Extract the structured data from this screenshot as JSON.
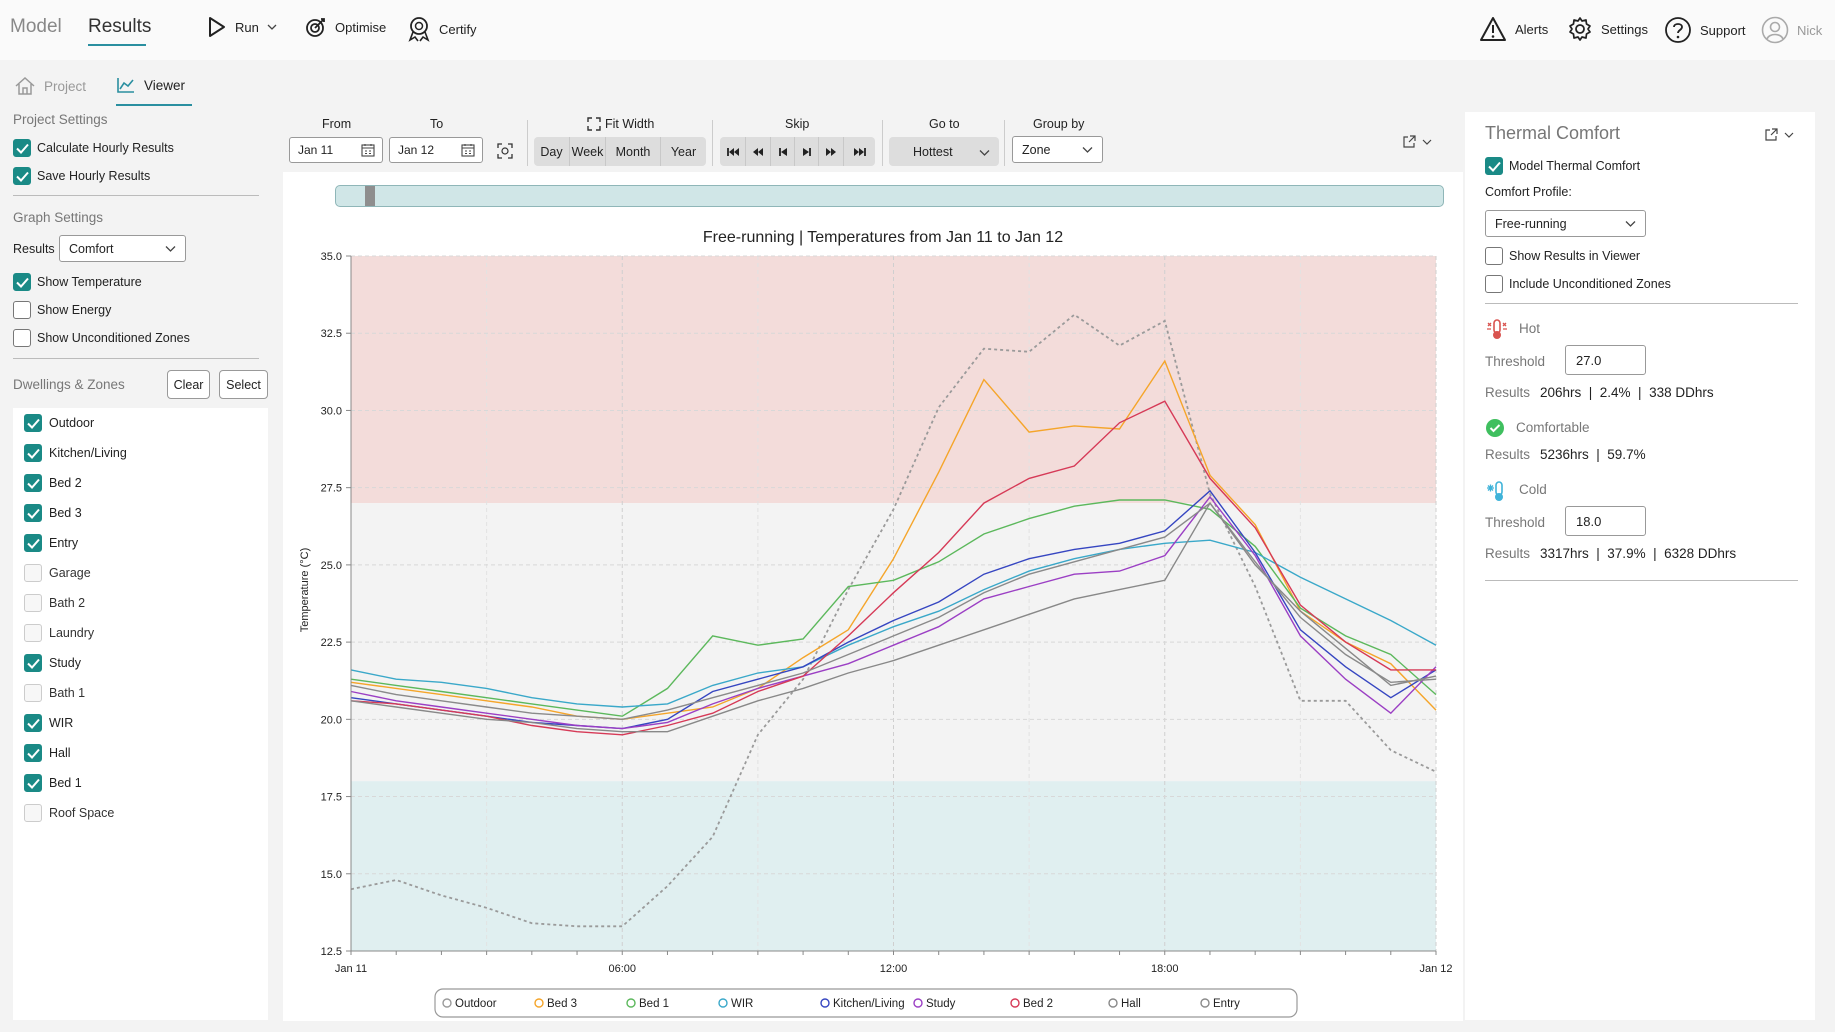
{
  "topbar": {
    "tabs": [
      {
        "label": "Model"
      },
      {
        "label": "Results"
      }
    ],
    "tools": {
      "run": "Run",
      "optimise": "Optimise",
      "certify": "Certify",
      "alerts": "Alerts",
      "settings": "Settings",
      "support": "Support",
      "user": "Nick"
    }
  },
  "subnav": {
    "project": "Project",
    "viewer": "Viewer"
  },
  "left": {
    "project_settings": {
      "title": "Project Settings",
      "items": [
        {
          "label": "Calculate Hourly Results",
          "checked": true
        },
        {
          "label": "Save Hourly Results",
          "checked": true
        }
      ]
    },
    "graph_settings": {
      "title": "Graph Settings",
      "results_label": "Results",
      "results_value": "Comfort",
      "items": [
        {
          "label": "Show Temperature",
          "checked": true
        },
        {
          "label": "Show Energy",
          "checked": false
        },
        {
          "label": "Show Unconditioned Zones",
          "checked": false
        }
      ]
    },
    "zones": {
      "title": "Dwellings & Zones",
      "clear": "Clear",
      "select": "Select",
      "items": [
        {
          "label": "Outdoor",
          "state": "on"
        },
        {
          "label": "Kitchen/Living",
          "state": "on"
        },
        {
          "label": "Bed 2",
          "state": "on"
        },
        {
          "label": "Bed 3",
          "state": "on"
        },
        {
          "label": "Entry",
          "state": "on"
        },
        {
          "label": "Garage",
          "state": "dis"
        },
        {
          "label": "Bath 2",
          "state": "dis"
        },
        {
          "label": "Laundry",
          "state": "dis"
        },
        {
          "label": "Study",
          "state": "on"
        },
        {
          "label": "Bath 1",
          "state": "dis"
        },
        {
          "label": "WIR",
          "state": "on"
        },
        {
          "label": "Hall",
          "state": "on"
        },
        {
          "label": "Bed 1",
          "state": "on"
        },
        {
          "label": "Roof Space",
          "state": "dis"
        }
      ]
    }
  },
  "controls": {
    "from_label": "From",
    "from_value": "Jan 11",
    "to_label": "To",
    "to_value": "Jan 12",
    "fit_width": "Fit Width",
    "periods": [
      "Day",
      "Week",
      "Month",
      "Year"
    ],
    "skip_label": "Skip",
    "goto_label": "Go to",
    "goto_value": "Hottest",
    "group_label": "Group by",
    "group_value": "Zone"
  },
  "chart_data": {
    "type": "line",
    "title": "Free-running | Temperatures from Jan 11 to Jan 12",
    "ylabel": "Temperature (°C)",
    "xlabel": "",
    "ylim": [
      12.5,
      35.0
    ],
    "yticks": [
      "35.0",
      "32.5",
      "30.0",
      "27.5",
      "25.0",
      "22.5",
      "20.0",
      "17.5",
      "15.0",
      "12.5"
    ],
    "xticks": [
      {
        "h": 0,
        "label": "Jan 11"
      },
      {
        "h": 6,
        "label": "06:00"
      },
      {
        "h": 12,
        "label": "12:00"
      },
      {
        "h": 18,
        "label": "18:00"
      },
      {
        "h": 24,
        "label": "Jan 12"
      }
    ],
    "bands": [
      {
        "name": "Hot",
        "from": 27.0,
        "to": 35.0,
        "color": "#f3dcda"
      },
      {
        "name": "Comfortable",
        "from": 18.0,
        "to": 27.0,
        "color": "#f3f3f3"
      },
      {
        "name": "Cold",
        "from": 12.5,
        "to": 18.0,
        "color": "#e0eff0"
      }
    ],
    "x_hours": [
      0,
      1,
      2,
      3,
      4,
      5,
      6,
      7,
      8,
      9,
      10,
      11,
      12,
      13,
      14,
      15,
      16,
      17,
      18,
      19,
      20,
      21,
      22,
      23,
      24
    ],
    "series": [
      {
        "name": "Outdoor",
        "color": "#9a9a9a",
        "dashed": true,
        "values": [
          14.5,
          14.8,
          14.3,
          13.9,
          13.4,
          13.3,
          13.3,
          14.6,
          16.2,
          19.5,
          21.3,
          24.2,
          26.8,
          30.1,
          32.0,
          31.9,
          33.1,
          32.1,
          32.9,
          27.3,
          24.3,
          20.6,
          20.6,
          19.0,
          18.3
        ]
      },
      {
        "name": "Bed 3",
        "color": "#f5a52a",
        "values": [
          21.2,
          21.0,
          20.8,
          20.6,
          20.4,
          20.1,
          20.0,
          20.2,
          20.4,
          21.0,
          22.0,
          22.9,
          25.2,
          28.0,
          31.0,
          29.3,
          29.5,
          29.4,
          31.6,
          27.9,
          26.3,
          23.5,
          22.5,
          21.8,
          20.3
        ]
      },
      {
        "name": "Bed 1",
        "color": "#5cb85c",
        "values": [
          21.3,
          21.1,
          20.9,
          20.7,
          20.5,
          20.3,
          20.1,
          21.0,
          22.7,
          22.4,
          22.6,
          24.3,
          24.5,
          25.1,
          26.0,
          26.5,
          26.9,
          27.1,
          27.1,
          26.8,
          25.6,
          23.6,
          22.7,
          22.1,
          20.8
        ]
      },
      {
        "name": "WIR",
        "color": "#3aa8c9",
        "values": [
          21.6,
          21.3,
          21.2,
          21.0,
          20.7,
          20.5,
          20.4,
          20.5,
          21.1,
          21.5,
          21.7,
          22.4,
          23.0,
          23.5,
          24.2,
          24.8,
          25.2,
          25.5,
          25.7,
          25.8,
          25.4,
          24.6,
          23.9,
          23.2,
          22.4
        ]
      },
      {
        "name": "Kitchen/Living",
        "color": "#3646c1",
        "values": [
          20.7,
          20.5,
          20.3,
          20.1,
          19.9,
          19.8,
          19.7,
          20.0,
          20.9,
          21.3,
          21.7,
          22.5,
          23.2,
          23.8,
          24.7,
          25.2,
          25.5,
          25.7,
          26.1,
          27.4,
          25.4,
          22.9,
          21.7,
          20.7,
          21.6
        ]
      },
      {
        "name": "Study",
        "color": "#9b3fc4",
        "values": [
          20.9,
          20.6,
          20.4,
          20.2,
          20.0,
          19.8,
          19.7,
          19.9,
          20.5,
          21.0,
          21.4,
          21.8,
          22.4,
          23.0,
          23.9,
          24.3,
          24.7,
          24.8,
          25.3,
          27.2,
          25.3,
          22.7,
          21.3,
          20.2,
          21.7
        ]
      },
      {
        "name": "Bed 2",
        "color": "#d63a57",
        "values": [
          20.6,
          20.5,
          20.3,
          20.1,
          19.8,
          19.6,
          19.5,
          19.8,
          20.2,
          20.9,
          21.4,
          22.7,
          24.1,
          25.4,
          27.0,
          27.8,
          28.2,
          29.6,
          30.3,
          27.8,
          26.2,
          23.7,
          22.5,
          21.6,
          21.6
        ]
      },
      {
        "name": "Hall",
        "color": "#888888",
        "values": [
          20.6,
          20.4,
          20.2,
          20.0,
          19.9,
          19.7,
          19.6,
          19.6,
          20.1,
          20.6,
          21.0,
          21.5,
          21.9,
          22.4,
          22.9,
          23.4,
          23.9,
          24.2,
          24.5,
          27.0,
          25.0,
          23.5,
          22.3,
          21.1,
          21.4
        ]
      },
      {
        "name": "Entry",
        "color": "#8a8a8a",
        "values": [
          21.1,
          20.8,
          20.6,
          20.4,
          20.2,
          20.1,
          20.0,
          20.3,
          20.7,
          21.1,
          21.5,
          22.1,
          22.7,
          23.3,
          24.1,
          24.7,
          25.1,
          25.5,
          25.9,
          27.0,
          25.1,
          23.3,
          22.1,
          21.2,
          21.3
        ]
      }
    ]
  },
  "right": {
    "title": "Thermal Comfort",
    "model_tc": "Model Thermal Comfort",
    "profile_label": "Comfort Profile:",
    "profile_value": "Free-running",
    "show_results": "Show Results in Viewer",
    "include_uncond": "Include Unconditioned Zones",
    "hot": {
      "label": "Hot",
      "threshold_label": "Threshold",
      "threshold": "27.0",
      "results_label": "Results",
      "results": "206hrs  |  2.4%  |  338 DDhrs"
    },
    "comfortable": {
      "label": "Comfortable",
      "results_label": "Results",
      "results": "5236hrs  |  59.7%"
    },
    "cold": {
      "label": "Cold",
      "threshold_label": "Threshold",
      "threshold": "18.0",
      "results_label": "Results",
      "results": "3317hrs  |  37.9%  |  6328 DDhrs"
    },
    "colors": {
      "hot": "#d9534f",
      "ok": "#3fbf5f",
      "cold": "#3fb3d9",
      "accent": "#1a8a86"
    }
  }
}
